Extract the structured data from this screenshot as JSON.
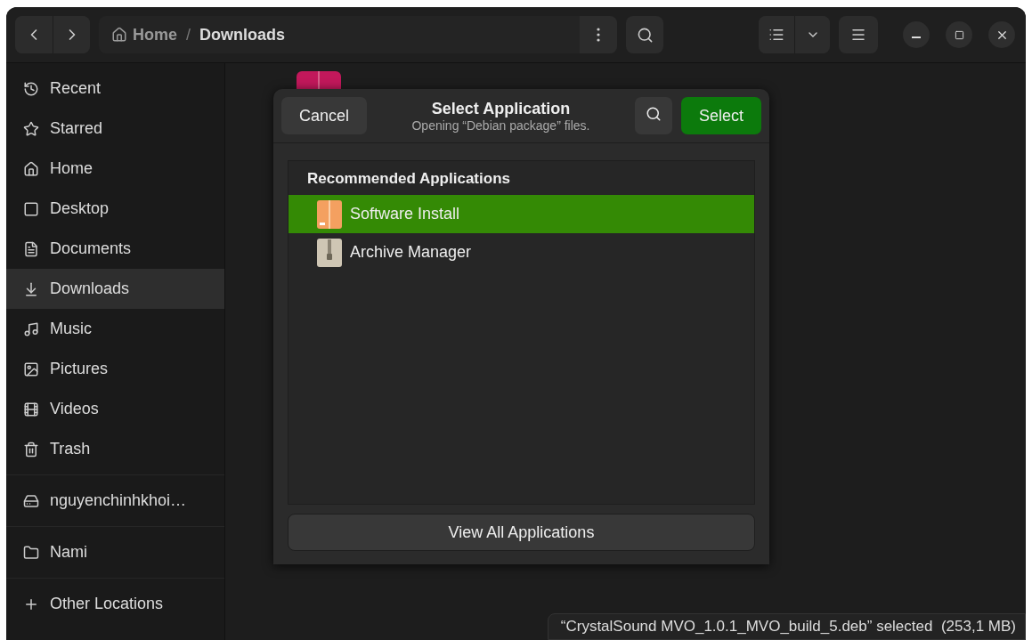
{
  "path_bar": {
    "separator": "/",
    "segments": [
      {
        "label": "Home",
        "current": false
      },
      {
        "label": "Downloads",
        "current": true
      }
    ]
  },
  "sidebar": {
    "groups": [
      [
        {
          "label": "Recent",
          "selected": false
        },
        {
          "label": "Starred",
          "selected": false
        },
        {
          "label": "Home",
          "selected": false
        },
        {
          "label": "Desktop",
          "selected": false
        },
        {
          "label": "Documents",
          "selected": false
        },
        {
          "label": "Downloads",
          "selected": true
        },
        {
          "label": "Music",
          "selected": false
        },
        {
          "label": "Pictures",
          "selected": false
        },
        {
          "label": "Videos",
          "selected": false
        },
        {
          "label": "Trash",
          "selected": false
        }
      ],
      [
        {
          "label": "nguyenchinhkhoi…",
          "selected": false
        }
      ],
      [
        {
          "label": "Nami",
          "selected": false
        }
      ],
      [
        {
          "label": "Other Locations",
          "selected": false
        }
      ]
    ]
  },
  "dialog": {
    "title": "Select Application",
    "subtitle": "Opening “Debian package” files.",
    "cancel": "Cancel",
    "select": "Select",
    "section": "Recommended Applications",
    "apps": [
      {
        "name": "Software Install",
        "kind": "installer",
        "selected": true
      },
      {
        "name": "Archive Manager",
        "kind": "archive",
        "selected": false
      }
    ],
    "view_all": "View All Applications"
  },
  "status": "“CrystalSound MVO_1.0.1_MVO_build_5.deb” selected  (253,1 MB)"
}
